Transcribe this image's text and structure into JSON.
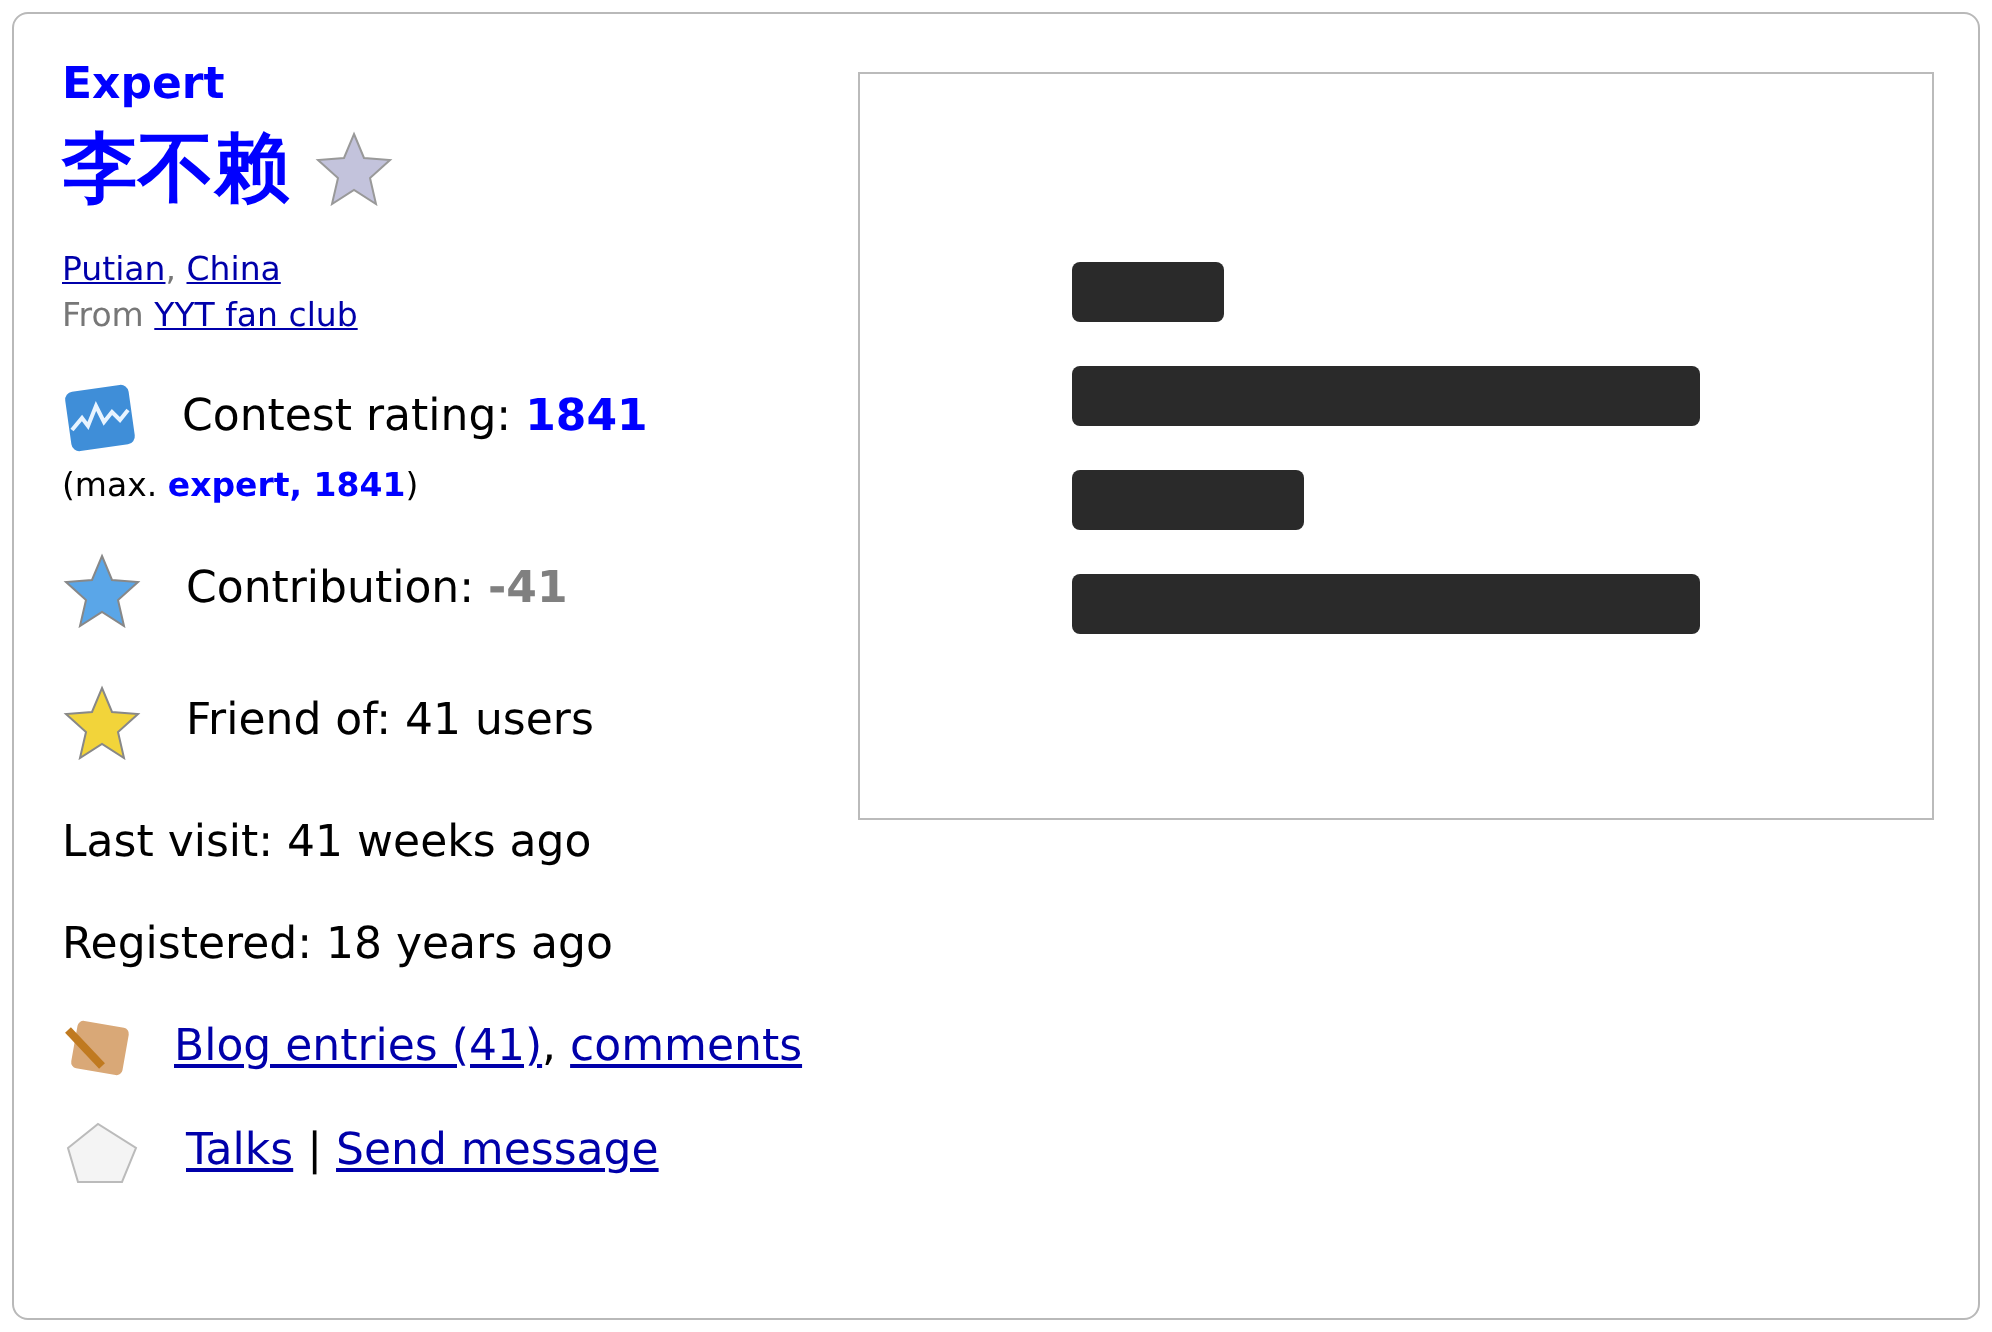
{
  "rank": "Expert",
  "handle": "李不赖",
  "location": {
    "city": "Putian",
    "separator": ",",
    "country": "China"
  },
  "organization": {
    "prefix": "From",
    "name": "YYT fan club"
  },
  "rating": {
    "label": "Contest rating:",
    "value": "1841",
    "max_open": "(max.",
    "max_value": "expert, 1841",
    "max_close": ")"
  },
  "contribution": {
    "label": "Contribution:",
    "value": "-41"
  },
  "friends": {
    "label": "Friend of:",
    "value": "41 users"
  },
  "last_visit": "Last visit: 41 weeks ago",
  "registered": "Registered: 18 years ago",
  "blog": {
    "entries": "Blog entries (41)",
    "separator": ",",
    "comments": "comments"
  },
  "messages": {
    "talks": "Talks",
    "separator": "|",
    "send": "Send message"
  }
}
